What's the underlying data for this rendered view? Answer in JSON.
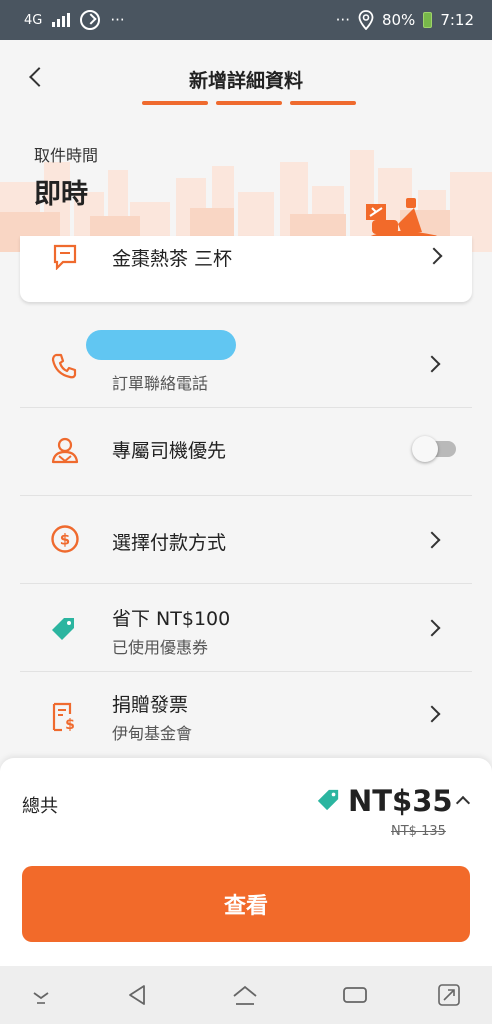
{
  "status_bar": {
    "network": "4G",
    "dots_left": "···",
    "dots_right": "···",
    "battery": "80%",
    "time": "7:12"
  },
  "header": {
    "title": "新增詳細資料",
    "progress_steps": 3
  },
  "pickup": {
    "label": "取件時間",
    "value": "即時"
  },
  "note": {
    "text": "金棗熱茶 三杯"
  },
  "rows": {
    "contact": {
      "sub": "訂單聯絡電話"
    },
    "driver": {
      "label": "專屬司機優先",
      "toggle_on": false
    },
    "payment": {
      "label": "選擇付款方式"
    },
    "coupon": {
      "label": "省下 NT$100",
      "sub": "已使用優惠券"
    },
    "invoice": {
      "label": "捐贈發票",
      "sub": "伊甸基金會"
    }
  },
  "summary": {
    "total_label": "總共",
    "price": "NT$35",
    "original_price": "NT$ 135",
    "cta_label": "查看"
  },
  "colors": {
    "accent": "#f26a2a",
    "coupon_tag": "#2bb5a0",
    "status_bar": "#4a5560"
  },
  "icons": {
    "note": "note-icon",
    "contact": "phone-icon",
    "driver": "driver-icon",
    "payment": "dollar-coin-icon",
    "coupon": "tag-icon",
    "invoice": "receipt-icon"
  }
}
